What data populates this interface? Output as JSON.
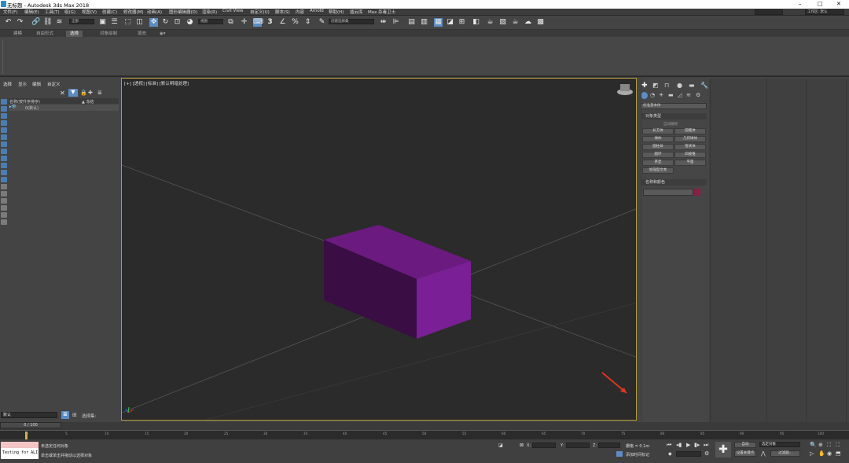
{
  "window": {
    "title": "无标题 - Autodesk 3ds Max 2018",
    "controls": [
      "–",
      "□",
      "✕"
    ]
  },
  "menus": [
    "文件(F)",
    "编辑(E)",
    "工具(T)",
    "组(G)",
    "视图(V)",
    "创建(C)",
    "修改器(M)",
    "动画(A)",
    "图形编辑器(D)",
    "渲染(R)",
    "Civil View",
    "自定义(U)",
    "脚本(S)",
    "内容",
    "Arnold",
    "帮助(H)",
    "插云库",
    "Max 杀毒卫士"
  ],
  "menu_right": {
    "workspace": "工作区: 默认",
    "login": "登录"
  },
  "toolbar": {
    "filter": "全部",
    "refcoord": "视图",
    "selset": "创建选择集",
    "snap_label": "3",
    "percent": "%"
  },
  "ribbon_tabs": [
    "建模",
    "自由形式",
    "选择",
    "对象绘制",
    "填充"
  ],
  "ribbon_active_index": 2,
  "scene_explorer": {
    "menus": [
      "选择",
      "显示",
      "编辑",
      "自定义"
    ],
    "col_name": "名称(按升序排序)",
    "col_frozen": "▲ 冻结",
    "root_item": "0(默认)",
    "layer": "默认",
    "selection_set_label": "选择集:"
  },
  "viewport": {
    "label": "[+] [透视] [标准] [默认明暗处理]",
    "box_color_top": "#6b1a80",
    "box_color_front": "#3a0d44",
    "box_color_right": "#7a1f95"
  },
  "command_panel": {
    "category": "标准基本体",
    "rollout_object_type": "对象类型",
    "autogrid": "自动栅格",
    "buttons": [
      "长方体",
      "圆锥体",
      "球体",
      "几何球体",
      "圆柱体",
      "管状体",
      "圆环",
      "四棱锥",
      "茶壶",
      "平面",
      "加强型文本"
    ],
    "rollout_name_color": "名称和颜色",
    "color_swatch": "#8a1e47"
  },
  "timeline": {
    "frame_display": "0 / 100",
    "ticks": [
      "0",
      "5",
      "10",
      "15",
      "20",
      "25",
      "30",
      "35",
      "40",
      "45",
      "50",
      "55",
      "60",
      "65",
      "70",
      "75",
      "80",
      "85",
      "90",
      "95",
      "100"
    ]
  },
  "status": {
    "maxscript_text": "Testing for ALI",
    "line1": "未选定任何对象",
    "line2": "单击或单击并拖动以选择对象",
    "x_label": "X:",
    "y_label": "Y:",
    "z_label": "Z:",
    "grid": "栅格 = 0.1m",
    "add_time_tag": "添加时间标记",
    "auto_key": "自动",
    "set_key": "设置关键点",
    "selected_object": "选定对象",
    "key_filters": "过滤器..."
  }
}
